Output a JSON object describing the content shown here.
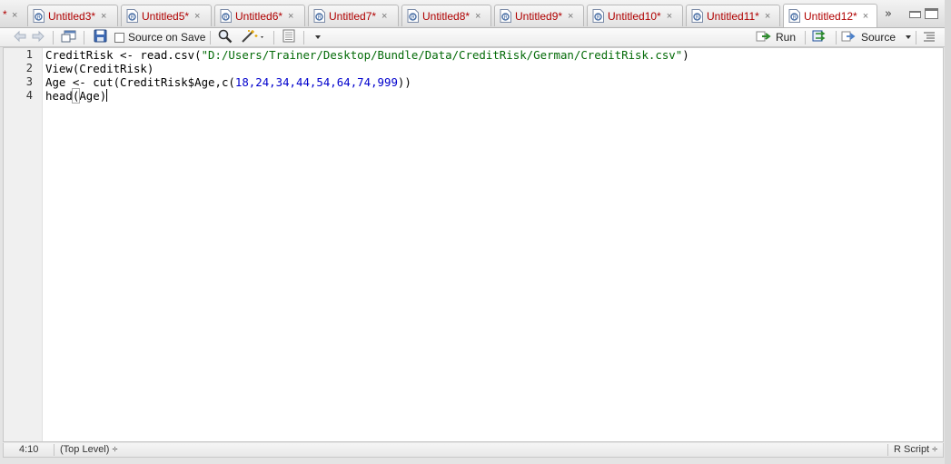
{
  "tabs": [
    {
      "label": "Untitled3*",
      "close": "×"
    },
    {
      "label": "Untitled5*",
      "close": "×"
    },
    {
      "label": "Untitled6*",
      "close": "×"
    },
    {
      "label": "Untitled7*",
      "close": "×"
    },
    {
      "label": "Untitled8*",
      "close": "×"
    },
    {
      "label": "Untitled9*",
      "close": "×"
    },
    {
      "label": "Untitled10*",
      "close": "×"
    },
    {
      "label": "Untitled11*",
      "close": "×"
    },
    {
      "label": "Untitled12*",
      "close": "×"
    }
  ],
  "partial_tab": {
    "label": "*",
    "close": "×"
  },
  "overflow_glyph": "»",
  "toolbar": {
    "source_on_save": "Source on Save",
    "source_on_save_checked": false,
    "run": "Run",
    "source": "Source"
  },
  "editor": {
    "line_numbers": [
      "1",
      "2",
      "3",
      "4"
    ],
    "lines": [
      {
        "p1": "CreditRisk <- read.csv(",
        "s": "\"D:/Users/Trainer/Desktop/Bundle/Data/CreditRisk/German/CreditRisk.csv\"",
        "p2": ")"
      },
      {
        "p1": "View(CreditRisk)"
      },
      {
        "p1": "Age <- cut(CreditRisk$Age,c(",
        "n": "18,24,34,44,54,64,74,999",
        "p2": "))"
      },
      {
        "p1": "head",
        "b1": "(",
        "p2": "Age",
        "b2": ")"
      }
    ]
  },
  "status": {
    "position": "4:10",
    "scope": "(Top Level) ÷",
    "filetype": "R Script ÷"
  },
  "colors": {
    "tab_text": "#b00000",
    "string": "#036a07",
    "number": "#0000cd",
    "run_arrow": "#2c8a2c"
  }
}
